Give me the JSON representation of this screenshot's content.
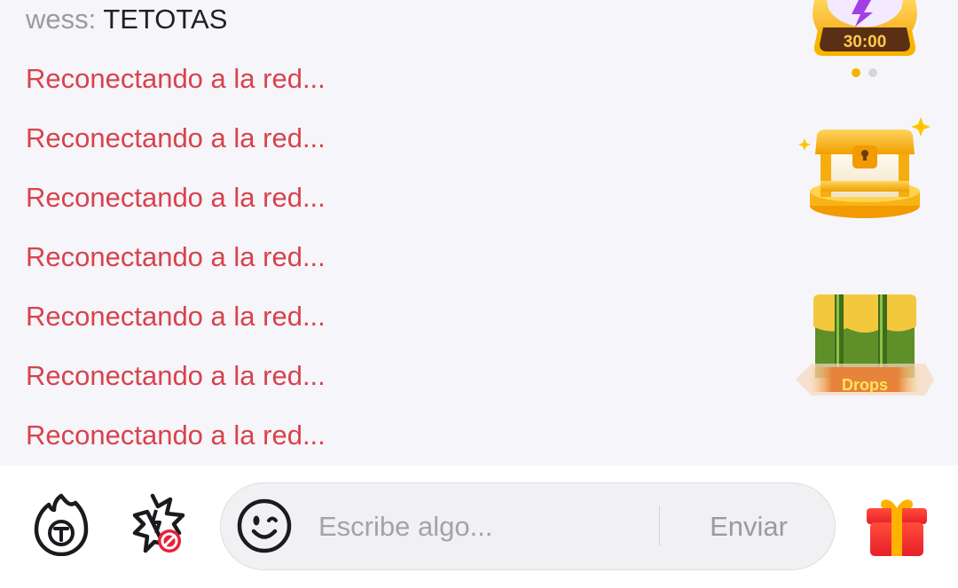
{
  "chat": {
    "user_message": {
      "username": "wess:",
      "text": "TETOTAS"
    },
    "system_messages": [
      "Reconectando a la red...",
      "Reconectando a la red...",
      "Reconectando a la red...",
      "Reconectando a la red...",
      "Reconectando a la red...",
      "Reconectando a la red...",
      "Reconectando a la red..."
    ]
  },
  "widgets": {
    "timer": {
      "time": "30:00",
      "page_dots": 2,
      "active_dot": 0
    },
    "drops": {
      "label": "Drops"
    }
  },
  "bottom_bar": {
    "input_placeholder": "Escribe algo...",
    "send_label": "Enviar"
  },
  "colors": {
    "system_text": "#d8424d",
    "accent_gold": "#f5b300",
    "gift_red": "#f0342f"
  },
  "icons": [
    "flame-t-icon",
    "lightning-blocked-icon",
    "smiley-icon",
    "gift-icon",
    "treasure-chest-icon",
    "drops-crate-icon",
    "timer-badge-icon"
  ]
}
